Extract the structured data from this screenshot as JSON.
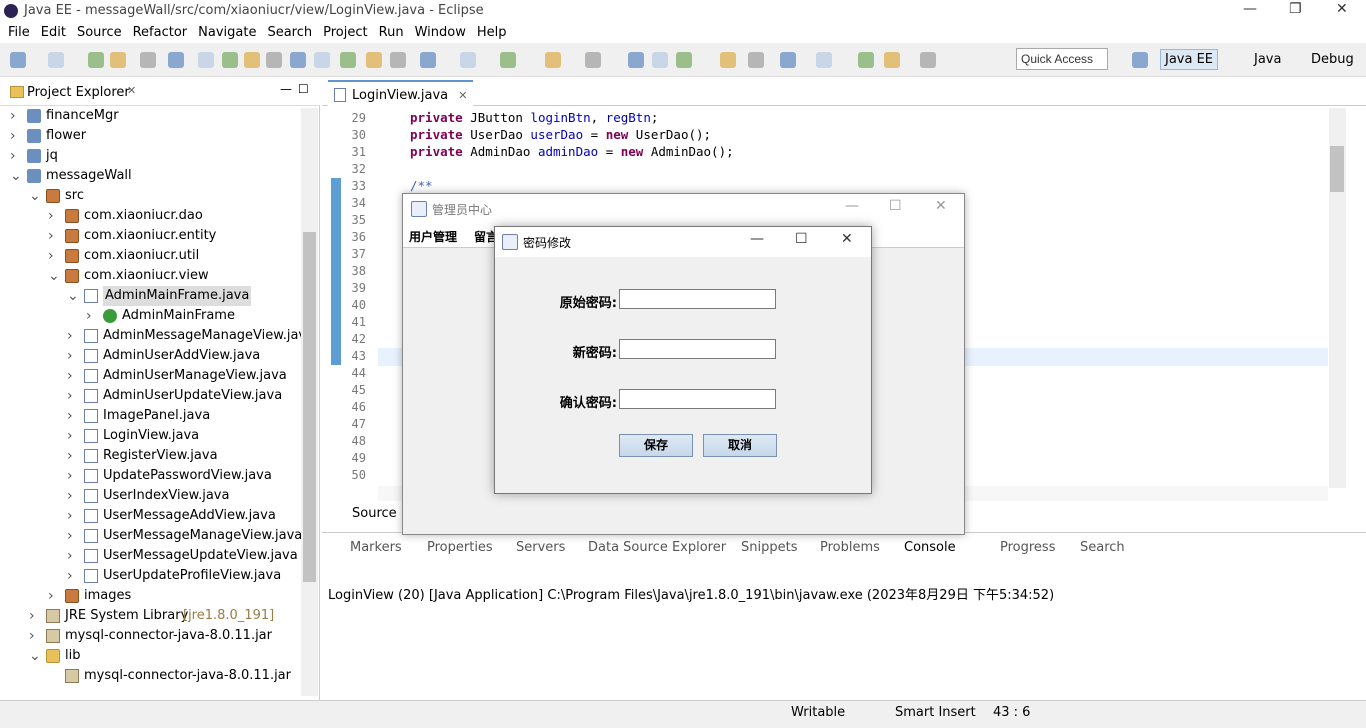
{
  "window": {
    "title": "Java EE - messageWall/src/com/xiaoniucr/view/LoginView.java - Eclipse"
  },
  "menu": [
    "File",
    "Edit",
    "Source",
    "Refactor",
    "Navigate",
    "Search",
    "Project",
    "Run",
    "Window",
    "Help"
  ],
  "toolbar": {
    "quick_access": "Quick Access"
  },
  "perspectives": [
    "Java EE",
    "Java",
    "Debug"
  ],
  "project_explorer": {
    "title": "Project Explorer",
    "items": [
      {
        "label": "financeMgr",
        "depth": 0,
        "arrow": ">",
        "icon": "proj"
      },
      {
        "label": "flower",
        "depth": 0,
        "arrow": ">",
        "icon": "proj"
      },
      {
        "label": "jq",
        "depth": 0,
        "arrow": ">",
        "icon": "proj"
      },
      {
        "label": "messageWall",
        "depth": 0,
        "arrow": "v",
        "icon": "proj"
      },
      {
        "label": "src",
        "depth": 1,
        "arrow": "v",
        "icon": "pkg"
      },
      {
        "label": "com.xiaoniucr.dao",
        "depth": 2,
        "arrow": ">",
        "icon": "pkg"
      },
      {
        "label": "com.xiaoniucr.entity",
        "depth": 2,
        "arrow": ">",
        "icon": "pkg"
      },
      {
        "label": "com.xiaoniucr.util",
        "depth": 2,
        "arrow": ">",
        "icon": "pkg"
      },
      {
        "label": "com.xiaoniucr.view",
        "depth": 2,
        "arrow": "v",
        "icon": "pkg"
      },
      {
        "label": "AdminMainFrame.java",
        "depth": 3,
        "arrow": "v",
        "icon": "jfile",
        "selected": true
      },
      {
        "label": "AdminMainFrame",
        "depth": 4,
        "arrow": ">",
        "icon": "cls"
      },
      {
        "label": "AdminMessageManageView.java",
        "depth": 3,
        "arrow": ">",
        "icon": "jfile"
      },
      {
        "label": "AdminUserAddView.java",
        "depth": 3,
        "arrow": ">",
        "icon": "jfile"
      },
      {
        "label": "AdminUserManageView.java",
        "depth": 3,
        "arrow": ">",
        "icon": "jfile"
      },
      {
        "label": "AdminUserUpdateView.java",
        "depth": 3,
        "arrow": ">",
        "icon": "jfile"
      },
      {
        "label": "ImagePanel.java",
        "depth": 3,
        "arrow": ">",
        "icon": "jfile"
      },
      {
        "label": "LoginView.java",
        "depth": 3,
        "arrow": ">",
        "icon": "jfile"
      },
      {
        "label": "RegisterView.java",
        "depth": 3,
        "arrow": ">",
        "icon": "jfile"
      },
      {
        "label": "UpdatePasswordView.java",
        "depth": 3,
        "arrow": ">",
        "icon": "jfile"
      },
      {
        "label": "UserIndexView.java",
        "depth": 3,
        "arrow": ">",
        "icon": "jfile"
      },
      {
        "label": "UserMessageAddView.java",
        "depth": 3,
        "arrow": ">",
        "icon": "jfile"
      },
      {
        "label": "UserMessageManageView.java",
        "depth": 3,
        "arrow": ">",
        "icon": "jfile"
      },
      {
        "label": "UserMessageUpdateView.java",
        "depth": 3,
        "arrow": ">",
        "icon": "jfile"
      },
      {
        "label": "UserUpdateProfileView.java",
        "depth": 3,
        "arrow": ">",
        "icon": "jfile"
      },
      {
        "label": "images",
        "depth": 2,
        "arrow": ">",
        "icon": "pkg"
      },
      {
        "label": "JRE System Library",
        "extra": "[jre1.8.0_191]",
        "depth": 1,
        "arrow": ">",
        "icon": "jar"
      },
      {
        "label": "mysql-connector-java-8.0.11.jar",
        "depth": 1,
        "arrow": ">",
        "icon": "jar"
      },
      {
        "label": "lib",
        "depth": 1,
        "arrow": "v",
        "icon": "folder"
      },
      {
        "label": "mysql-connector-java-8.0.11.jar",
        "depth": 2,
        "arrow": "",
        "icon": "jar"
      }
    ]
  },
  "editor": {
    "tab": "LoginView.java",
    "lines": [
      {
        "n": "29",
        "code": [
          [
            "kw",
            "private"
          ],
          [
            "",
            " JButton "
          ],
          [
            "fld",
            "loginBtn"
          ],
          [
            "",
            ", "
          ],
          [
            "fld",
            "regBtn"
          ],
          [
            "",
            ";"
          ]
        ]
      },
      {
        "n": "30",
        "code": [
          [
            "kw",
            "private"
          ],
          [
            "",
            " UserDao "
          ],
          [
            "fld",
            "userDao"
          ],
          [
            "",
            " = "
          ],
          [
            "kw",
            "new"
          ],
          [
            "",
            " UserDao();"
          ]
        ]
      },
      {
        "n": "31",
        "code": [
          [
            "kw",
            "private"
          ],
          [
            "",
            " AdminDao "
          ],
          [
            "fld",
            "adminDao"
          ],
          [
            "",
            " = "
          ],
          [
            "kw",
            "new"
          ],
          [
            "",
            " AdminDao();"
          ]
        ]
      },
      {
        "n": "32",
        "code": []
      },
      {
        "n": "33",
        "code": [
          [
            "cmt",
            "/**"
          ]
        ]
      },
      {
        "n": "34",
        "code": []
      },
      {
        "n": "35",
        "code": []
      },
      {
        "n": "36",
        "code": []
      },
      {
        "n": "37",
        "code": []
      },
      {
        "n": "38",
        "code": []
      },
      {
        "n": "39",
        "code": []
      },
      {
        "n": "40",
        "code": []
      },
      {
        "n": "41",
        "code": []
      },
      {
        "n": "42",
        "code": []
      },
      {
        "n": "43",
        "code": []
      },
      {
        "n": "44",
        "code": []
      },
      {
        "n": "45",
        "code": []
      },
      {
        "n": "46",
        "code": []
      },
      {
        "n": "47",
        "code": []
      },
      {
        "n": "48",
        "code": []
      },
      {
        "n": "49",
        "code": []
      },
      {
        "n": "50",
        "code": []
      }
    ],
    "source_tab": "Source"
  },
  "console": {
    "tabs": [
      "Markers",
      "Properties",
      "Servers",
      "Data Source Explorer",
      "Snippets",
      "Problems",
      "Console",
      "Progress",
      "Search"
    ],
    "active": "Console",
    "text": "LoginView (20) [Java Application] C:\\Program Files\\Java\\jre1.8.0_191\\bin\\javaw.exe (2023年8月29日 下午5:34:52)"
  },
  "status": {
    "writable": "Writable",
    "insert": "Smart Insert",
    "position": "43 : 6"
  },
  "admin_frame": {
    "title": "管理员中心",
    "menu": [
      "用户管理",
      "留言"
    ]
  },
  "dialog": {
    "title": "密码修改",
    "labels": {
      "old": "原始密码:",
      "new": "新密码:",
      "confirm": "确认密码:"
    },
    "values": {
      "old": "",
      "new": "",
      "confirm": ""
    },
    "save": "保存",
    "cancel": "取消"
  }
}
